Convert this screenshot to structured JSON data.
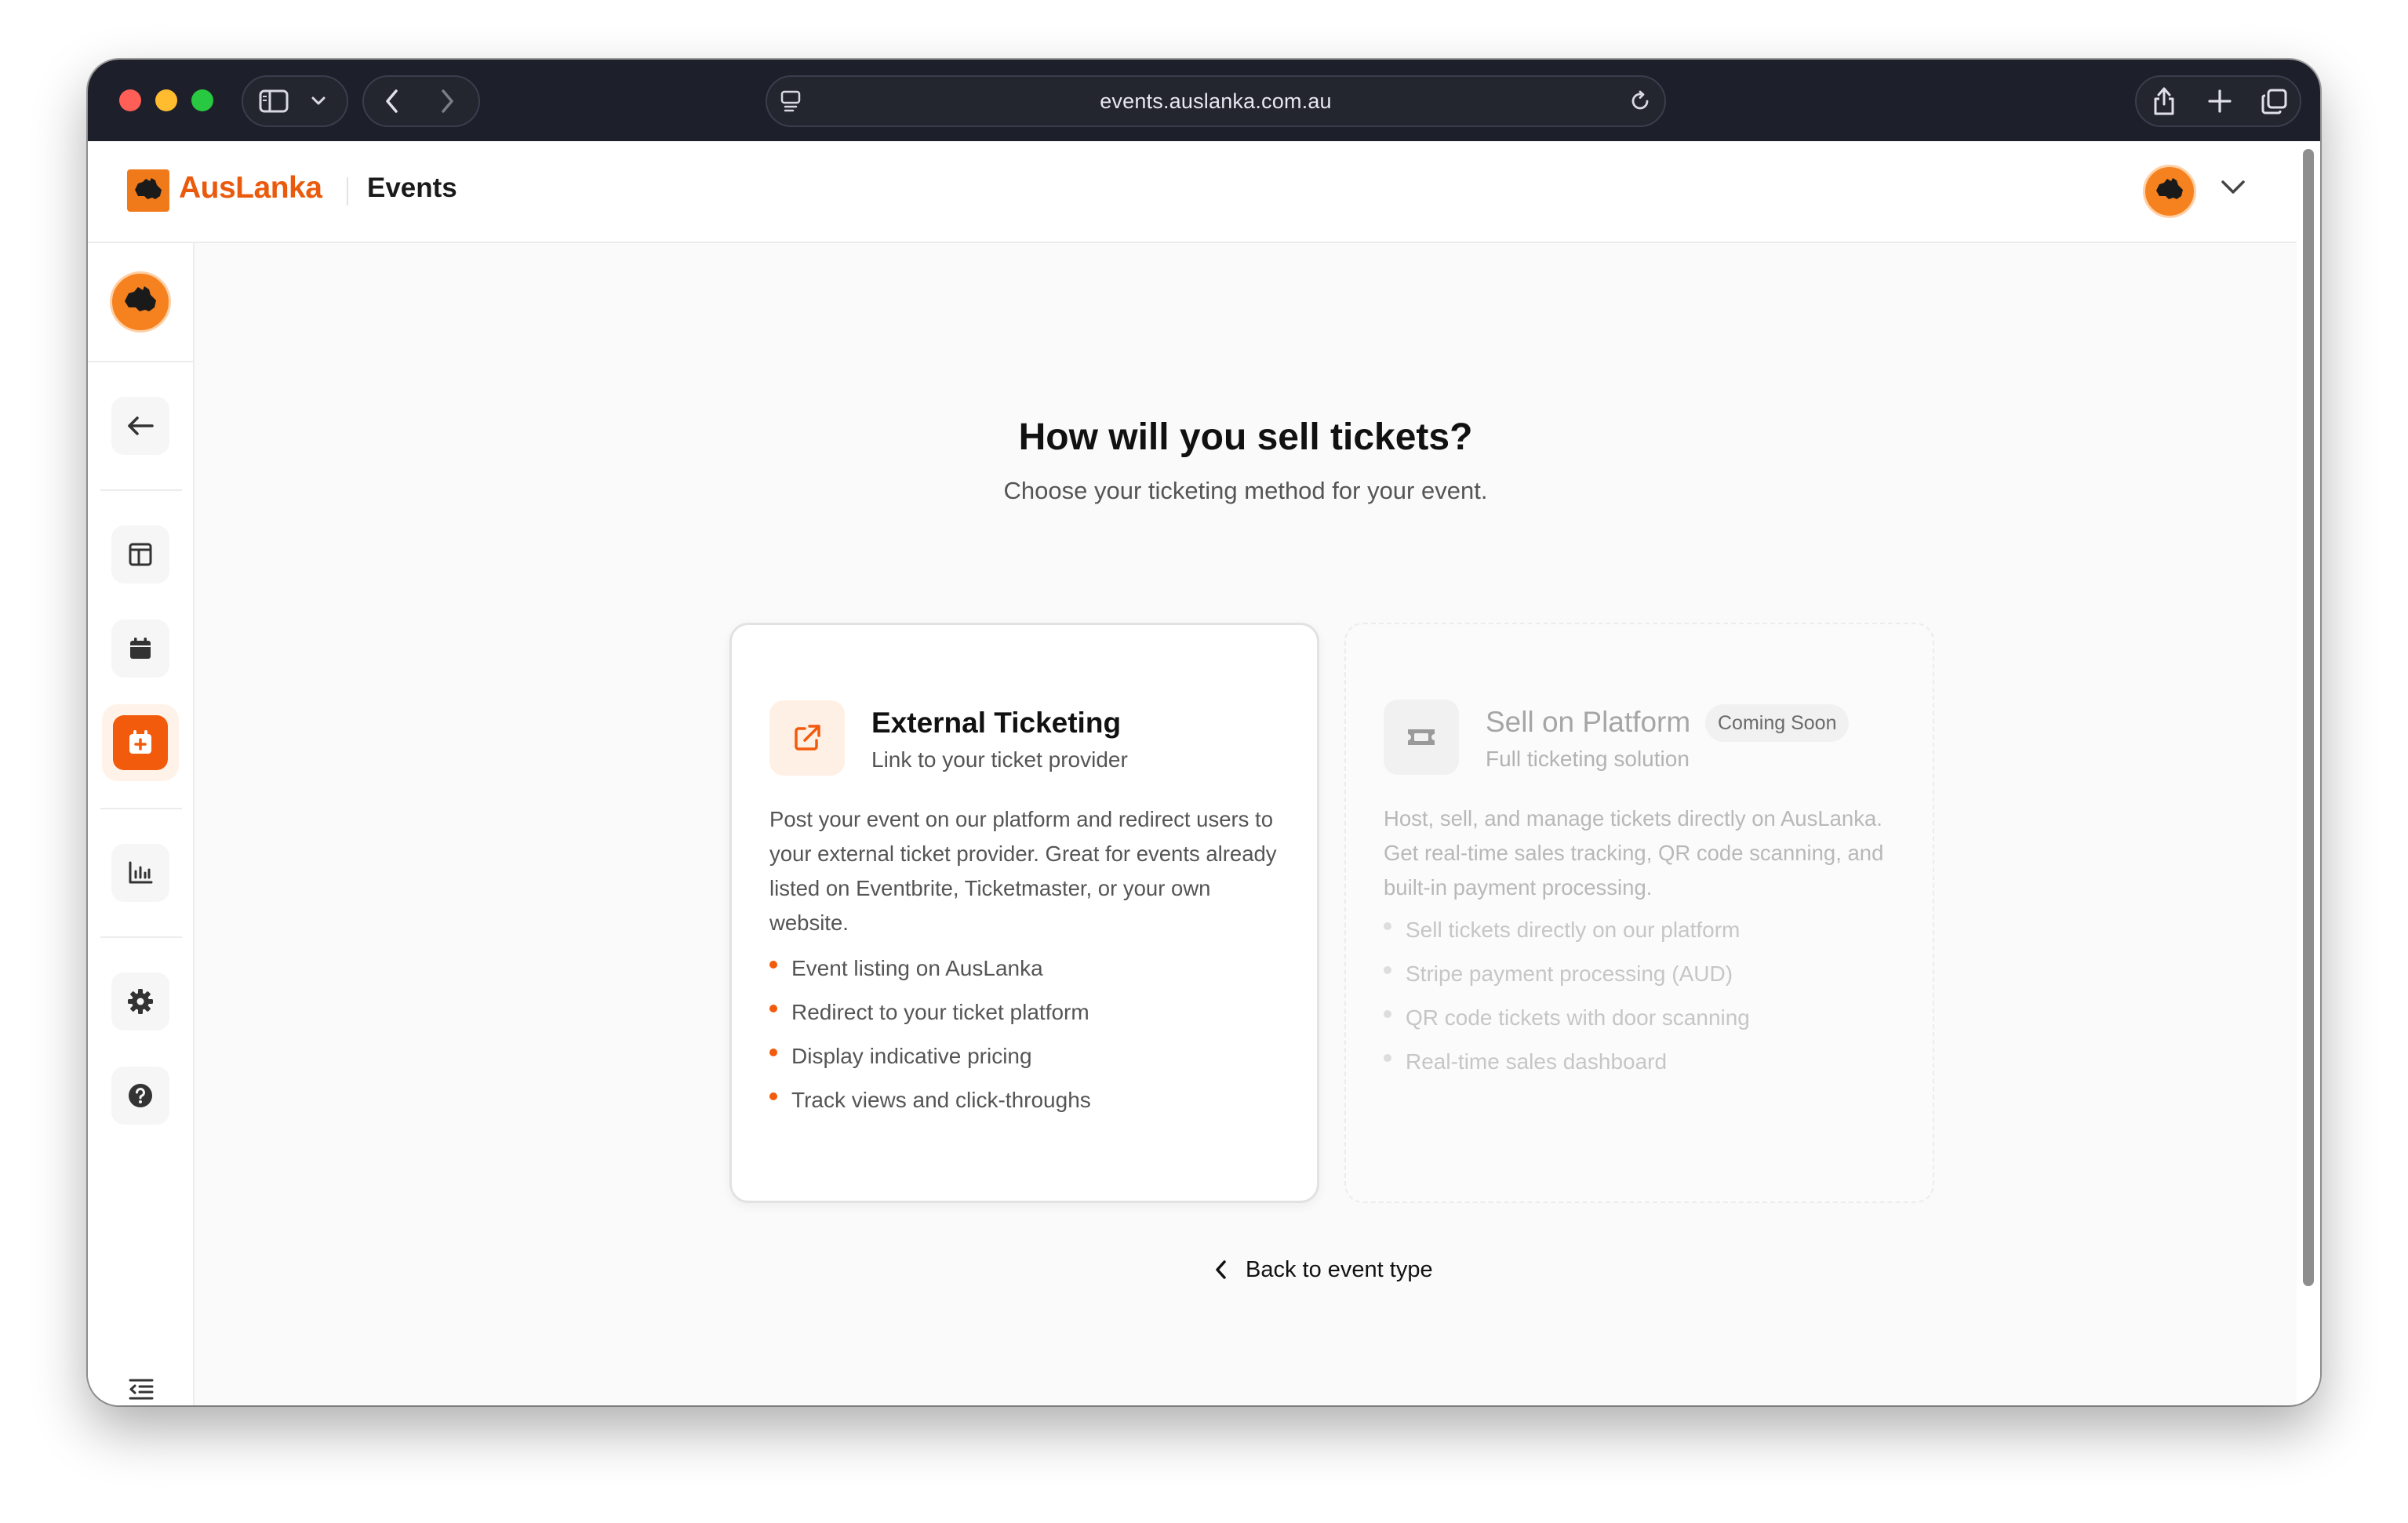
{
  "browser": {
    "url": "events.auslanka.com.au",
    "icons": [
      "sidebar-toggle-icon",
      "chevron-down-icon",
      "back-icon",
      "forward-icon",
      "site-settings-icon",
      "reload-icon",
      "share-icon",
      "new-tab-icon",
      "tabs-overview-icon"
    ]
  },
  "header": {
    "brand": "AusLanka",
    "section": "Events"
  },
  "sidebar": {
    "items": [
      {
        "name": "back",
        "icon": "arrow-left-icon"
      },
      {
        "name": "dashboard",
        "icon": "layout-icon"
      },
      {
        "name": "calendar",
        "icon": "calendar-icon"
      },
      {
        "name": "create-event",
        "icon": "calendar-plus-icon",
        "active": true
      },
      {
        "name": "analytics",
        "icon": "bar-chart-icon"
      },
      {
        "name": "settings",
        "icon": "gear-icon"
      },
      {
        "name": "help",
        "icon": "help-circle-icon"
      }
    ]
  },
  "main": {
    "title": "How will you sell tickets?",
    "subtitle": "Choose your ticketing method for your event.",
    "back_label": "Back to event type"
  },
  "cards": {
    "external": {
      "title": "External Ticketing",
      "subtitle": "Link to your ticket provider",
      "description": "Post your event on our platform and redirect users to your external ticket provider. Great for events already listed on Eventbrite, Ticketmaster, or your own website.",
      "features": [
        "Event listing on AusLanka",
        "Redirect to your ticket platform",
        "Display indicative pricing",
        "Track views and click-throughs"
      ]
    },
    "platform": {
      "title": "Sell on Platform",
      "badge": "Coming Soon",
      "subtitle": "Full ticketing solution",
      "description": "Host, sell, and manage tickets directly on AusLanka. Get real-time sales tracking, QR code scanning, and built-in payment processing.",
      "features": [
        "Sell tickets directly on our platform",
        "Stripe payment processing (AUD)",
        "QR code tickets with door scanning",
        "Real-time sales dashboard"
      ]
    }
  },
  "colors": {
    "accent": "#f25a0c",
    "brand": "#ea5a0c",
    "chrome": "#1d1f2b"
  }
}
